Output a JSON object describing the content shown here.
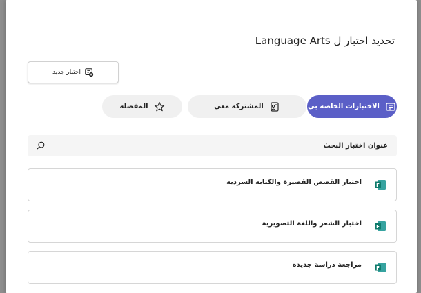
{
  "dialog": {
    "title": "تحديد اختبار ل Language Arts",
    "new_quiz_label": "اختبار جديد"
  },
  "tabs": [
    {
      "label": "الاختبارات الخاصة بي",
      "icon": "quiz-list-icon",
      "selected": true
    },
    {
      "label": "المشتركة معي",
      "icon": "shared-folder-icon",
      "selected": false
    },
    {
      "label": "المفضلة",
      "icon": "star-icon",
      "selected": false
    }
  ],
  "search": {
    "placeholder": "عنوان اختبار البحث",
    "value": ""
  },
  "quizzes": [
    {
      "title": "اختبار القصص القصيرة والكتابة السردية",
      "icon": "forms-icon"
    },
    {
      "title": "اختبار الشعر واللغة التصويرية",
      "icon": "forms-icon"
    },
    {
      "title": "مراجعة دراسة جديدة",
      "icon": "forms-icon"
    }
  ],
  "colors": {
    "accent": "#5b5fc7",
    "forms_green": "#0f7b6c",
    "pill_bg": "#f0f0f0"
  }
}
